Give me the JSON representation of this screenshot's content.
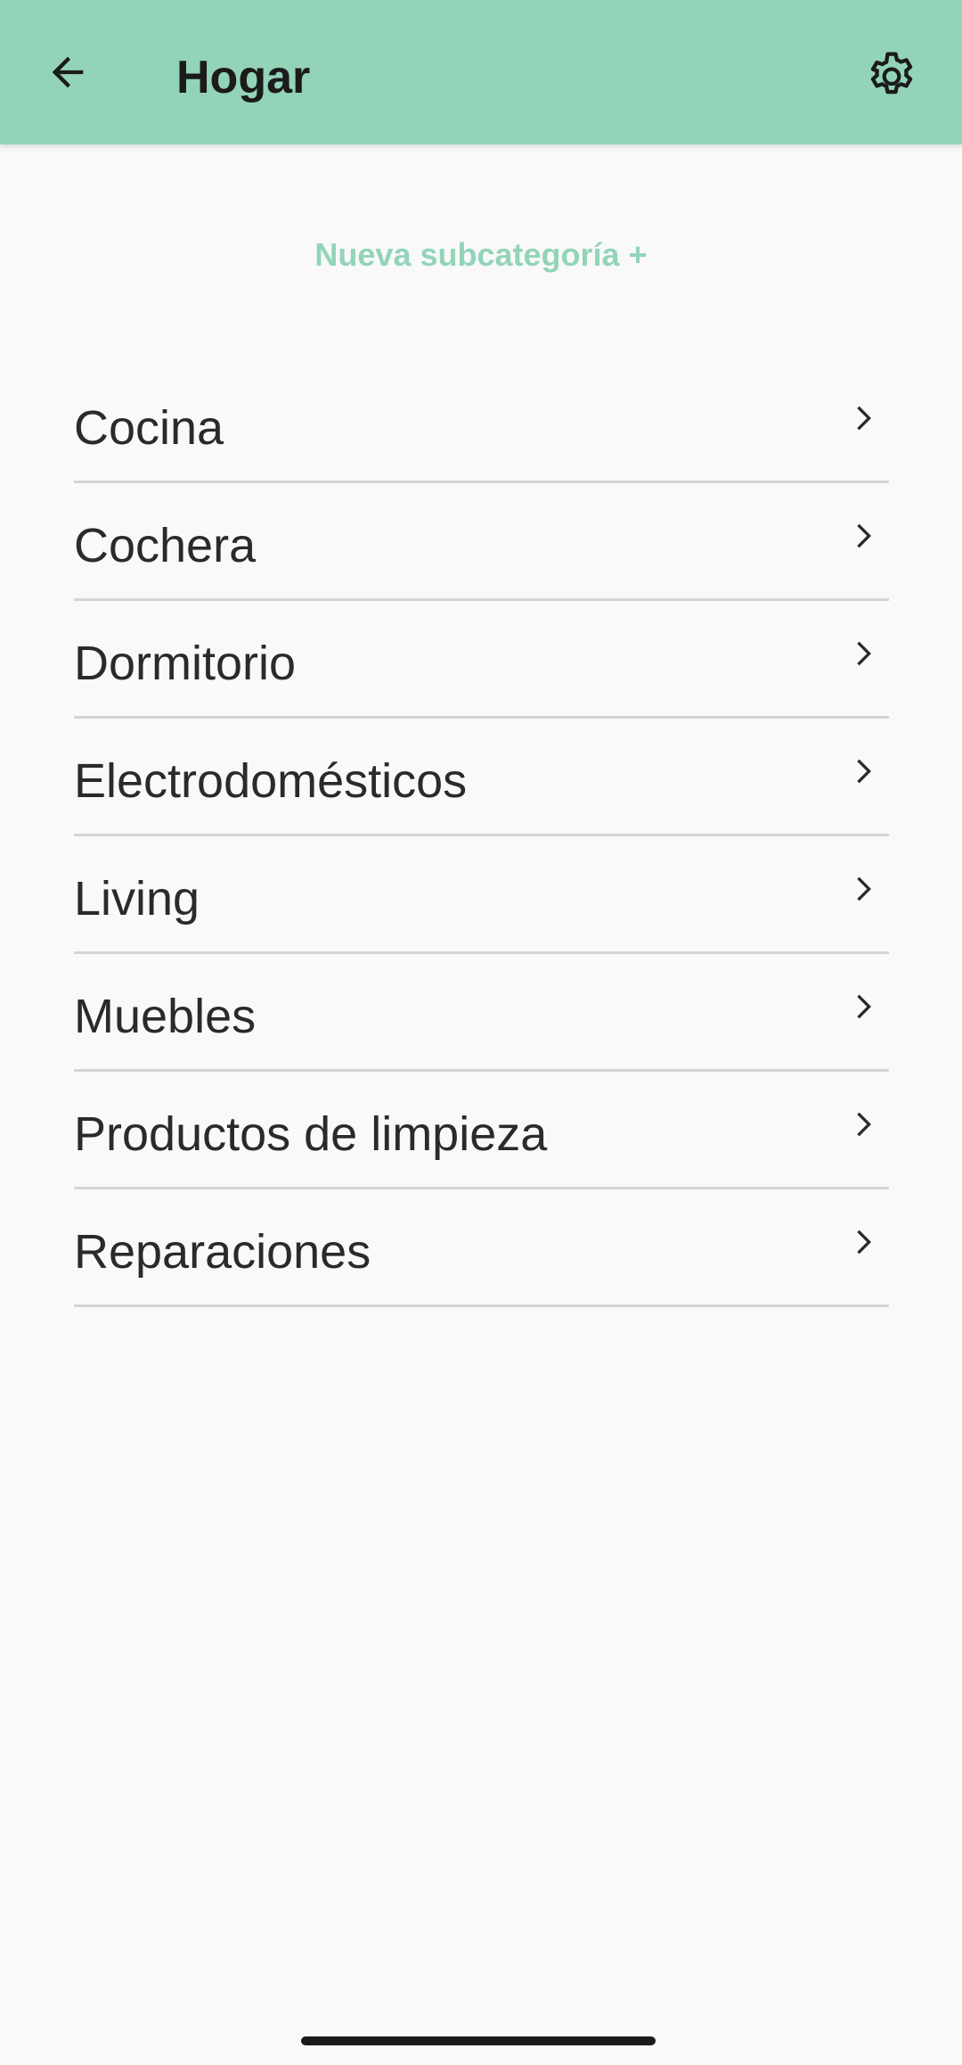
{
  "header": {
    "title": "Hogar",
    "back_icon": "arrow-left-icon",
    "settings_icon": "gear-icon"
  },
  "new_subcategory_label": "Nueva subcategoría +",
  "subcategories": [
    {
      "label": "Cocina"
    },
    {
      "label": "Cochera"
    },
    {
      "label": "Dormitorio"
    },
    {
      "label": "Electrodomésticos"
    },
    {
      "label": "Living"
    },
    {
      "label": "Muebles"
    },
    {
      "label": "Productos de limpieza"
    },
    {
      "label": "Reparaciones"
    }
  ],
  "colors": {
    "accent": "#93d4b9",
    "background": "#f9f9f9",
    "divider": "#d4d4d4",
    "text": "#2a2a2a"
  }
}
